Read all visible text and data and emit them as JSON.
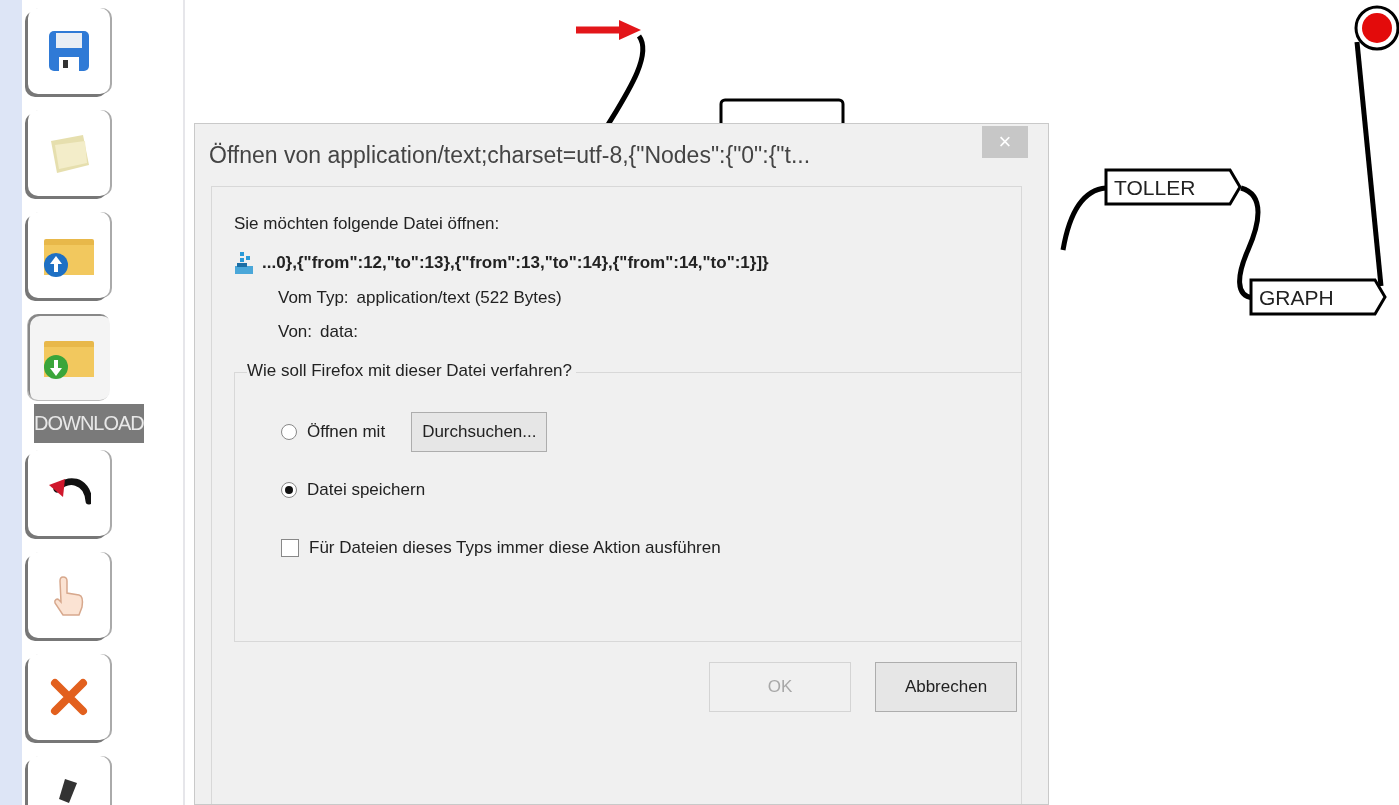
{
  "toolbar": {
    "buttons": [
      {
        "kind": "save",
        "pressed": false
      },
      {
        "kind": "file",
        "pressed": false
      },
      {
        "kind": "upload",
        "pressed": false
      },
      {
        "kind": "download",
        "pressed": true,
        "tooltip": "DOWNLOAD"
      },
      {
        "kind": "undo",
        "pressed": false
      },
      {
        "kind": "hand",
        "pressed": false
      },
      {
        "kind": "delete",
        "pressed": false
      },
      {
        "kind": "pen",
        "pressed": false
      }
    ]
  },
  "diagram": {
    "nodes": [
      {
        "label": "TOLLER"
      },
      {
        "label": "GRAPH"
      }
    ]
  },
  "dialog": {
    "title": "Öffnen von application/text;charset=utf-8,{\"Nodes\":{\"0\":{\"t...",
    "close": "×",
    "intro": "Sie möchten folgende Datei öffnen:",
    "filename": "...0},{\"from\":12,\"to\":13},{\"from\":13,\"to\":14},{\"from\":14,\"to\":1}]}",
    "details": [
      {
        "label": "Vom Typ:",
        "value": "application/text (522 Bytes)"
      },
      {
        "label": "Von:",
        "value": "data:"
      }
    ],
    "question": "Wie soll Firefox mit dieser Datei verfahren?",
    "options": [
      {
        "kind": "radio",
        "label": "Öffnen mit",
        "selected": false,
        "button": "Durchsuchen..."
      },
      {
        "kind": "radio",
        "label": "Datei speichern",
        "selected": true
      },
      {
        "kind": "checkbox",
        "label": "Für Dateien dieses Typs immer diese Aktion ausführen",
        "checked": false
      }
    ],
    "buttons": [
      {
        "label": "OK",
        "disabled": true
      },
      {
        "label": "Abbrechen",
        "disabled": false
      }
    ]
  }
}
